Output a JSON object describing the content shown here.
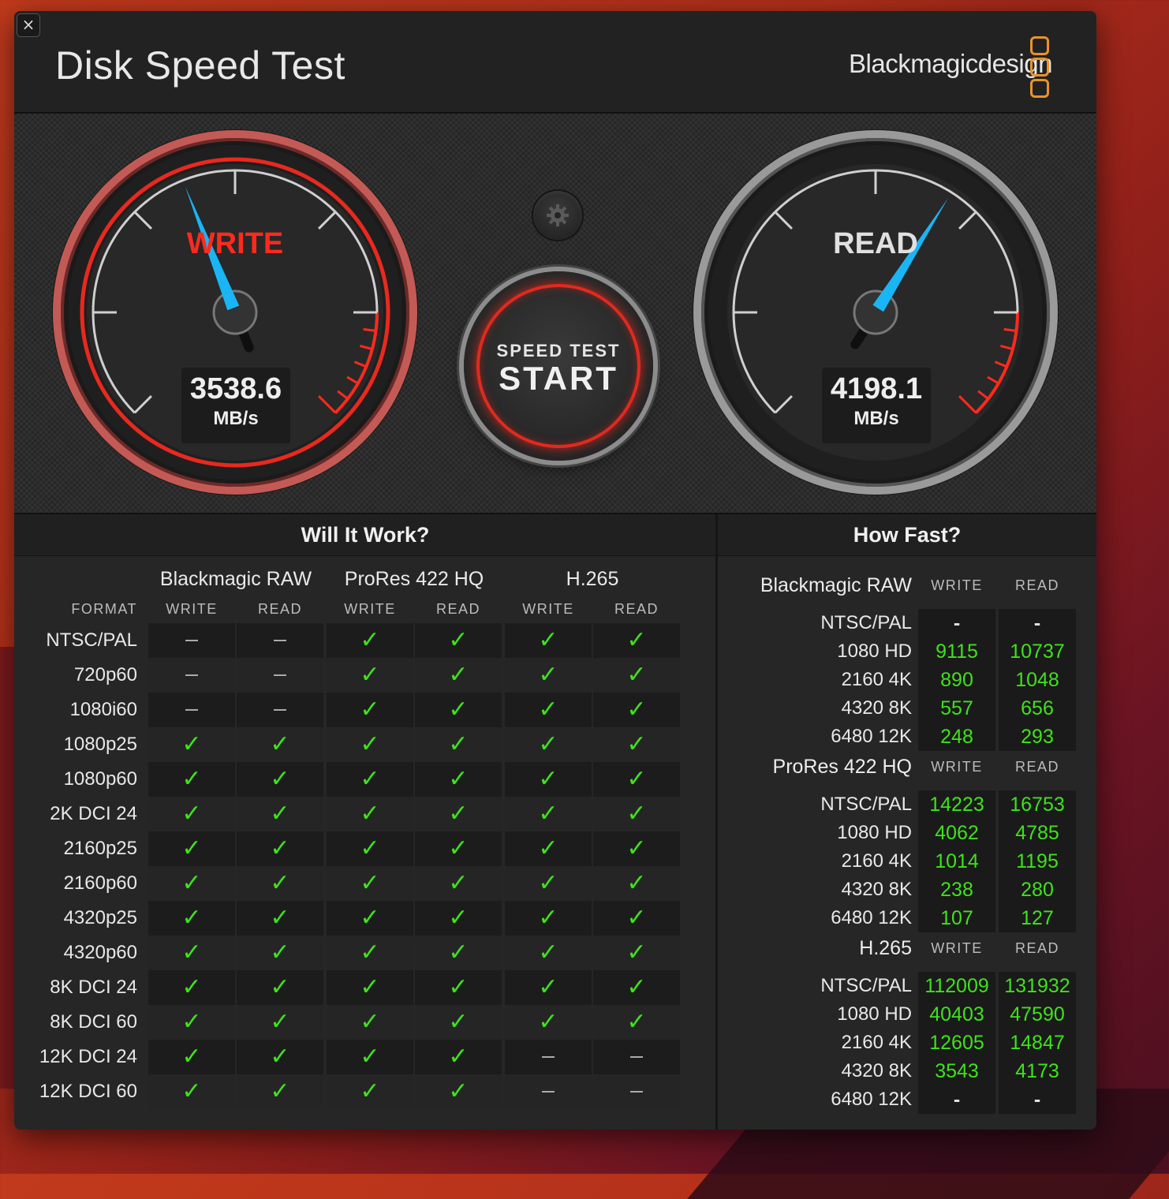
{
  "window": {
    "close_icon": "×",
    "title": "Disk Speed Test",
    "brand": "Blackmagicdesign"
  },
  "gauges": {
    "write": {
      "label": "WRITE",
      "value": "3538.6",
      "unit": "MB/s",
      "needle_fraction": 0.42
    },
    "read": {
      "label": "READ",
      "value": "4198.1",
      "unit": "MB/s",
      "needle_fraction": 0.62
    },
    "max_mbps": 8400
  },
  "start_button": {
    "top": "SPEED TEST",
    "main": "START"
  },
  "colors": {
    "write_accent": "#ff2a1e",
    "needle": "#19b5f5",
    "check": "#3fe21b",
    "brand_orange": "#e8932b"
  },
  "will_it_work": {
    "title": "Will It Work?",
    "format_header": "FORMAT",
    "groups": [
      {
        "name": "Blackmagic RAW",
        "write": "WRITE",
        "read": "READ"
      },
      {
        "name": "ProRes 422 HQ",
        "write": "WRITE",
        "read": "READ"
      },
      {
        "name": "H.265",
        "write": "WRITE",
        "read": "READ"
      }
    ],
    "rows": [
      {
        "format": "NTSC/PAL",
        "cells": [
          "-",
          "-",
          "y",
          "y",
          "y",
          "y"
        ]
      },
      {
        "format": "720p60",
        "cells": [
          "-",
          "-",
          "y",
          "y",
          "y",
          "y"
        ]
      },
      {
        "format": "1080i60",
        "cells": [
          "-",
          "-",
          "y",
          "y",
          "y",
          "y"
        ]
      },
      {
        "format": "1080p25",
        "cells": [
          "y",
          "y",
          "y",
          "y",
          "y",
          "y"
        ]
      },
      {
        "format": "1080p60",
        "cells": [
          "y",
          "y",
          "y",
          "y",
          "y",
          "y"
        ]
      },
      {
        "format": "2K DCI 24",
        "cells": [
          "y",
          "y",
          "y",
          "y",
          "y",
          "y"
        ]
      },
      {
        "format": "2160p25",
        "cells": [
          "y",
          "y",
          "y",
          "y",
          "y",
          "y"
        ]
      },
      {
        "format": "2160p60",
        "cells": [
          "y",
          "y",
          "y",
          "y",
          "y",
          "y"
        ]
      },
      {
        "format": "4320p25",
        "cells": [
          "y",
          "y",
          "y",
          "y",
          "y",
          "y"
        ]
      },
      {
        "format": "4320p60",
        "cells": [
          "y",
          "y",
          "y",
          "y",
          "y",
          "y"
        ]
      },
      {
        "format": "8K DCI 24",
        "cells": [
          "y",
          "y",
          "y",
          "y",
          "y",
          "y"
        ]
      },
      {
        "format": "8K DCI 60",
        "cells": [
          "y",
          "y",
          "y",
          "y",
          "y",
          "y"
        ]
      },
      {
        "format": "12K DCI 24",
        "cells": [
          "y",
          "y",
          "y",
          "y",
          "-",
          "-"
        ]
      },
      {
        "format": "12K DCI 60",
        "cells": [
          "y",
          "y",
          "y",
          "y",
          "-",
          "-"
        ]
      }
    ]
  },
  "how_fast": {
    "title": "How Fast?",
    "sections": [
      {
        "name": "Blackmagic RAW",
        "write": "WRITE",
        "read": "READ",
        "rows": [
          {
            "res": "NTSC/PAL",
            "w": "-",
            "r": "-"
          },
          {
            "res": "1080 HD",
            "w": "9115",
            "r": "10737"
          },
          {
            "res": "2160 4K",
            "w": "890",
            "r": "1048"
          },
          {
            "res": "4320 8K",
            "w": "557",
            "r": "656"
          },
          {
            "res": "6480 12K",
            "w": "248",
            "r": "293"
          }
        ]
      },
      {
        "name": "ProRes 422 HQ",
        "write": "WRITE",
        "read": "READ",
        "rows": [
          {
            "res": "NTSC/PAL",
            "w": "14223",
            "r": "16753"
          },
          {
            "res": "1080 HD",
            "w": "4062",
            "r": "4785"
          },
          {
            "res": "2160 4K",
            "w": "1014",
            "r": "1195"
          },
          {
            "res": "4320 8K",
            "w": "238",
            "r": "280"
          },
          {
            "res": "6480 12K",
            "w": "107",
            "r": "127"
          }
        ]
      },
      {
        "name": "H.265",
        "write": "WRITE",
        "read": "READ",
        "rows": [
          {
            "res": "NTSC/PAL",
            "w": "112009",
            "r": "131932"
          },
          {
            "res": "1080 HD",
            "w": "40403",
            "r": "47590"
          },
          {
            "res": "2160 4K",
            "w": "12605",
            "r": "14847"
          },
          {
            "res": "4320 8K",
            "w": "3543",
            "r": "4173"
          },
          {
            "res": "6480 12K",
            "w": "-",
            "r": "-"
          }
        ]
      }
    ]
  }
}
